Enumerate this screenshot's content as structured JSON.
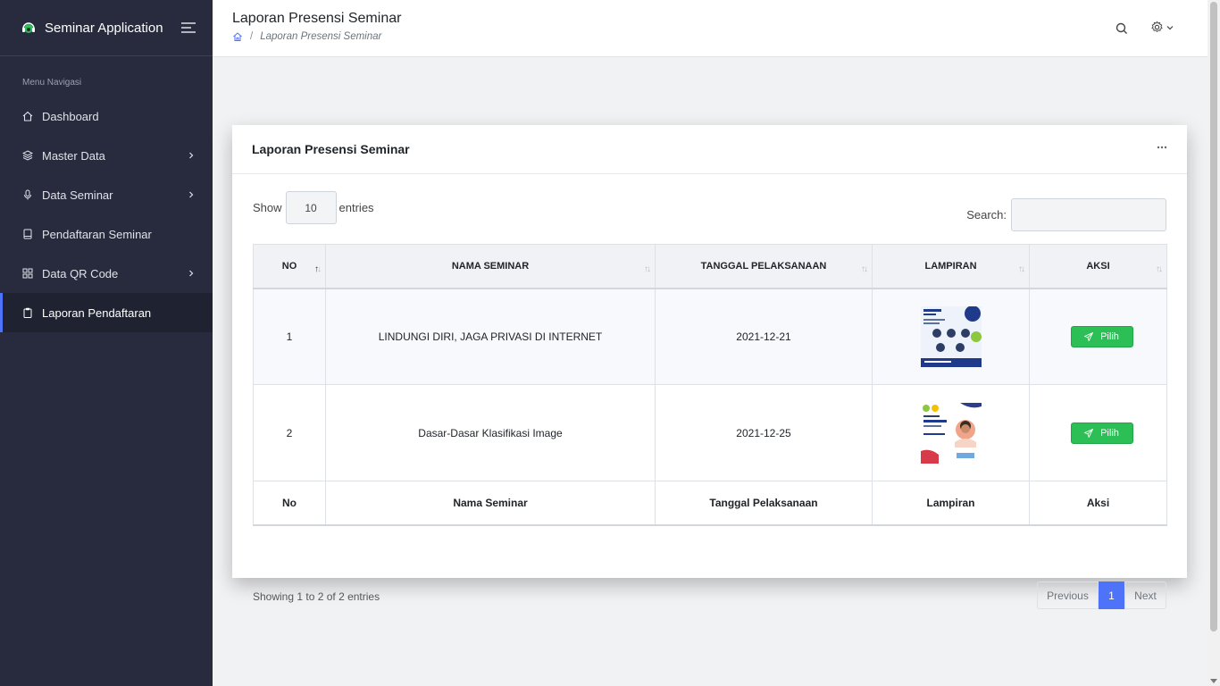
{
  "app": {
    "title": "Seminar Application"
  },
  "sidebar": {
    "section_label": "Menu Navigasi",
    "items": [
      {
        "label": "Dashboard",
        "icon": "home-icon",
        "has_children": false
      },
      {
        "label": "Master Data",
        "icon": "layers-icon",
        "has_children": true
      },
      {
        "label": "Data Seminar",
        "icon": "mic-icon",
        "has_children": true
      },
      {
        "label": "Pendaftaran Seminar",
        "icon": "book-icon",
        "has_children": false
      },
      {
        "label": "Data QR Code",
        "icon": "grid-icon",
        "has_children": true
      },
      {
        "label": "Laporan Pendaftaran",
        "icon": "clipboard-icon",
        "has_children": false,
        "active": true
      }
    ]
  },
  "header": {
    "title": "Laporan Presensi Seminar",
    "breadcrumb": "Laporan Presensi Seminar"
  },
  "card": {
    "title": "Laporan Presensi Seminar"
  },
  "table_controls": {
    "show_label": "Show",
    "entries_value": "10",
    "entries_label": "entries",
    "search_label": "Search:",
    "search_value": ""
  },
  "table": {
    "columns": [
      "NO",
      "NAMA SEMINAR",
      "TANGGAL PELAKSANAAN",
      "LAMPIRAN",
      "AKSI"
    ],
    "footer": [
      "No",
      "Nama Seminar",
      "Tanggal Pelaksanaan",
      "Lampiran",
      "Aksi"
    ],
    "rows": [
      {
        "no": "1",
        "nama": "LINDUNGI DIRI, JAGA PRIVASI DI INTERNET",
        "tanggal": "2021-12-21",
        "action": "Pilih"
      },
      {
        "no": "2",
        "nama": "Dasar-Dasar Klasifikasi Image",
        "tanggal": "2021-12-25",
        "action": "Pilih"
      }
    ]
  },
  "footer_info": "Showing 1 to 2 of 2 entries",
  "pagination": {
    "previous": "Previous",
    "current": "1",
    "next": "Next"
  },
  "colors": {
    "sidebar_bg": "#272b3d",
    "accent": "#4e73f8",
    "success": "#2bbf55"
  }
}
